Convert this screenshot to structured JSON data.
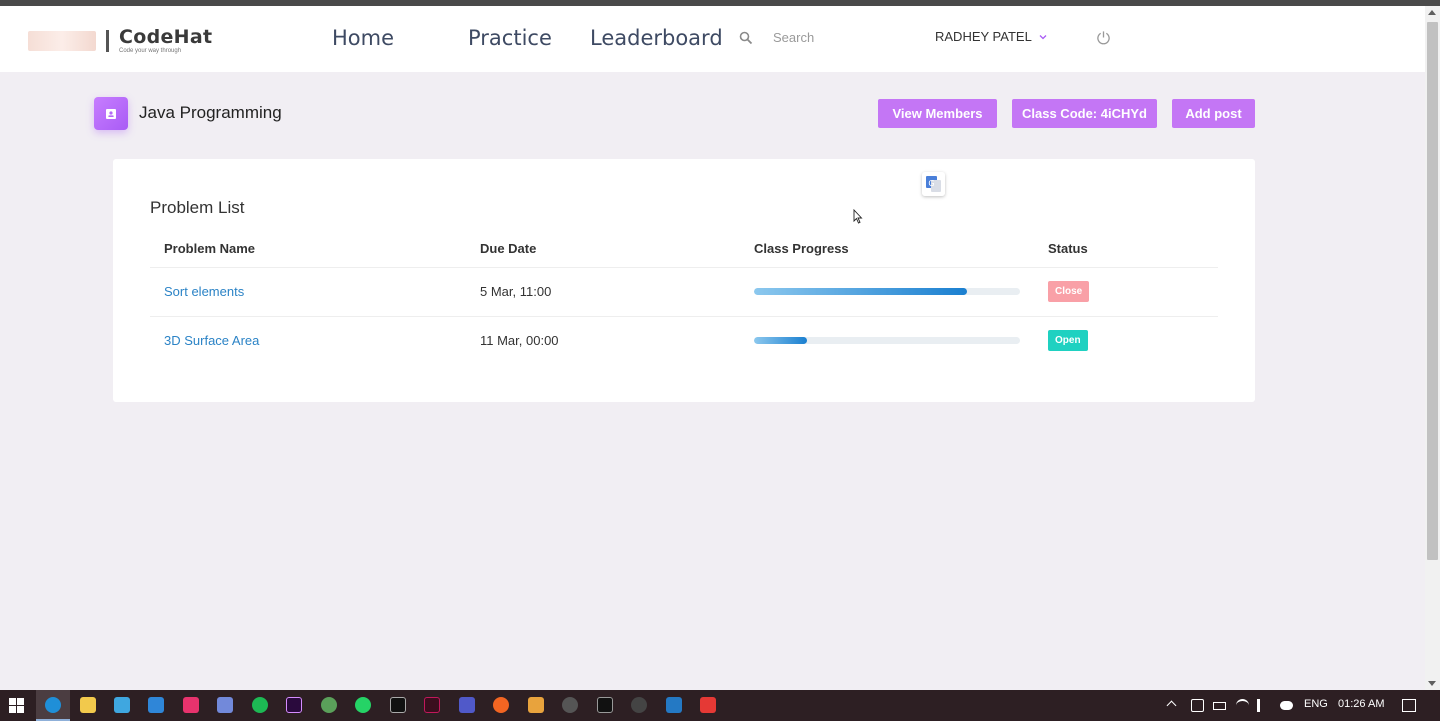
{
  "navbar": {
    "brand": "CodeHat",
    "tagline": "Code your way through",
    "links": [
      "Home",
      "Practice",
      "Leaderboard"
    ],
    "search_placeholder": "Search",
    "user_name": "RADHEY PATEL"
  },
  "class": {
    "title": "Java Programming",
    "buttons": {
      "view_members": "View Members",
      "class_code": "Class Code: 4iCHYd",
      "add_post": "Add post"
    }
  },
  "problems": {
    "title": "Problem List",
    "columns": [
      "Problem Name",
      "Due Date",
      "Class Progress",
      "Status"
    ],
    "rows": [
      {
        "name": "Sort elements",
        "due": "5 Mar, 11:00",
        "progress": 0.8,
        "status": "Close"
      },
      {
        "name": "3D Surface Area",
        "due": "11 Mar, 00:00",
        "progress": 0.2,
        "status": "Open"
      }
    ]
  },
  "colors": {
    "accent": "#c476f5",
    "link": "#2b83c6",
    "status_close": "#f9a0a7",
    "status_open": "#1fd1c1"
  },
  "taskbar": {
    "language": "ENG",
    "time": "01:26 AM"
  }
}
